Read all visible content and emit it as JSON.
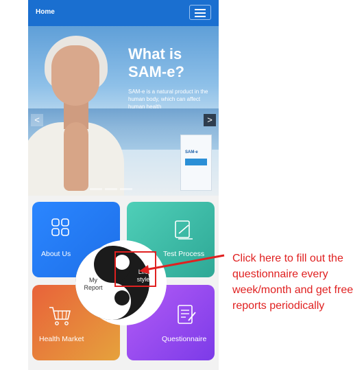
{
  "header": {
    "title": "Home",
    "menu_icon": "hamburger-menu-icon"
  },
  "banner": {
    "headline": "What is SAM-e?",
    "subtext": "SAM-e is a natural product in the human body, which can affect human health",
    "prev_icon": "chevron-left-icon",
    "next_icon": "chevron-right-icon",
    "next_glyph": ">",
    "prev_glyph": "<",
    "product_name": "SAM-e"
  },
  "tiles": {
    "about": {
      "label": "About Us",
      "icon": "grid-icon"
    },
    "test": {
      "label": "Test Process",
      "icon": "test-process-icon"
    },
    "health": {
      "label": "Health Market",
      "icon": "shopping-cart-icon"
    },
    "quest": {
      "label": "Questionnaire",
      "icon": "checklist-icon"
    }
  },
  "hub": {
    "my_report": "My Report",
    "lifestyle": "Life style"
  },
  "annotation": {
    "text": "Click here to fill out the questionnaire every week/month and get free reports periodically",
    "color": "#e02020"
  },
  "colors": {
    "header": "#1a6fd0",
    "about": "#2b86ff",
    "test": "#3fbfa8",
    "health": "#e8623a",
    "quest": "#9b4cf0"
  }
}
